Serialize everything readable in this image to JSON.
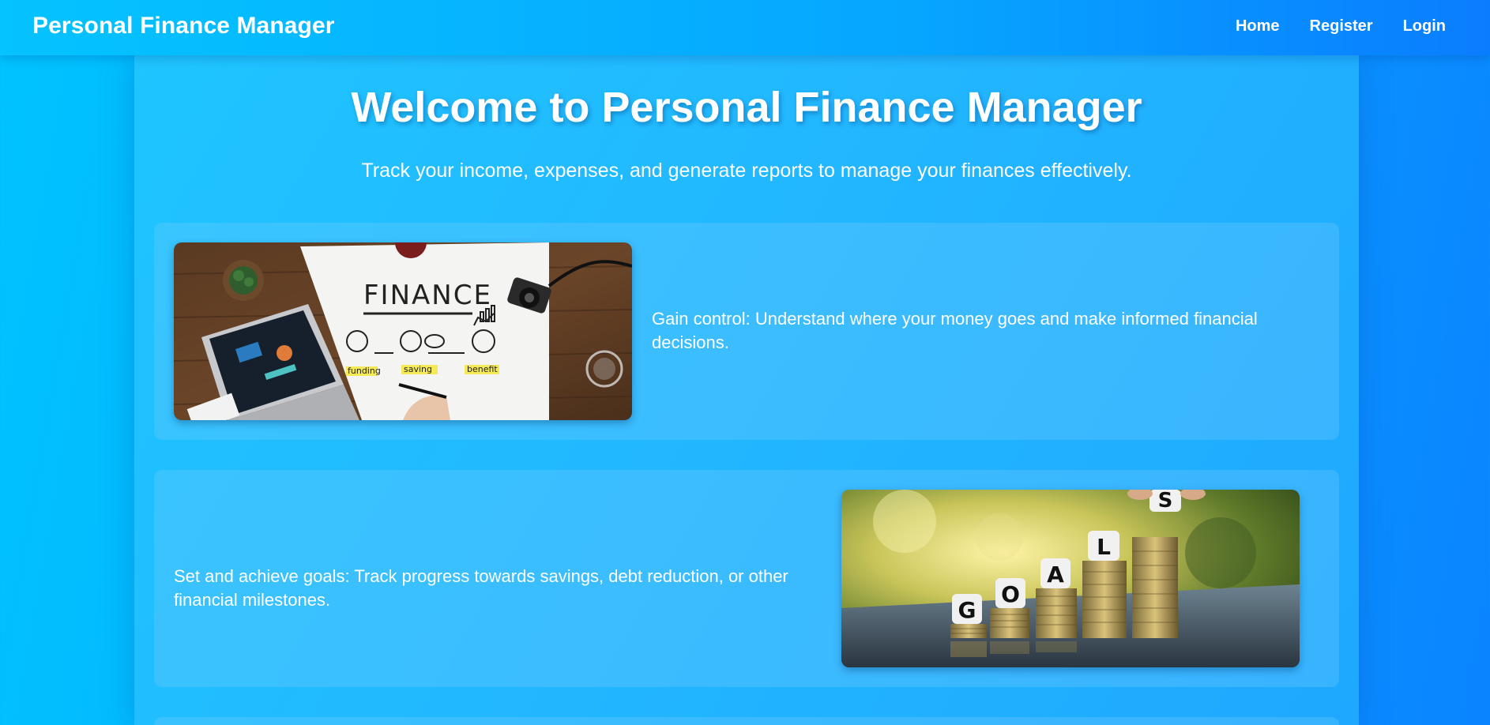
{
  "navbar": {
    "brand": "Personal Finance Manager",
    "links": [
      "Home",
      "Register",
      "Login"
    ]
  },
  "hero": {
    "title": "Welcome to Personal Finance Manager",
    "subtitle": "Track your income, expenses, and generate reports to manage your finances effectively."
  },
  "features": [
    {
      "text": "Gain control: Understand where your money goes and make informed financial decisions.",
      "image": {
        "heading": "FINANCE",
        "labels": [
          "funding",
          "saving",
          "benefit"
        ]
      }
    },
    {
      "text": "Set and achieve goals: Track progress towards savings, debt reduction, or other financial milestones.",
      "image": {
        "letters": [
          "G",
          "O",
          "A",
          "L",
          "S"
        ]
      }
    }
  ],
  "colors": {
    "background_start": "#00c3ff",
    "background_end": "#0a84ff",
    "text": "#ffffff"
  }
}
